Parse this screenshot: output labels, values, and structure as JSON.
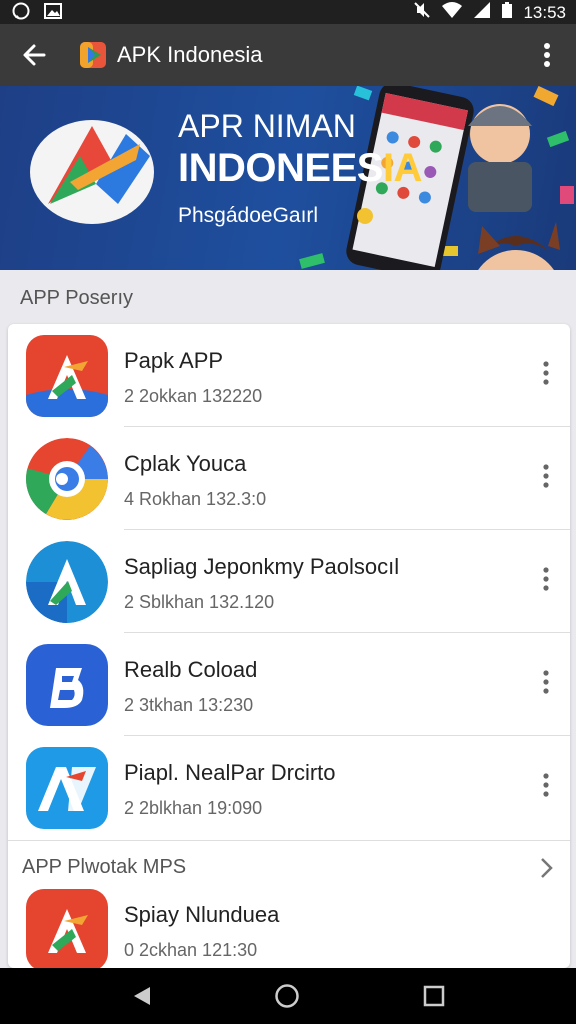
{
  "status_bar": {
    "time": "13:53",
    "left_icons": [
      "whatsapp-icon",
      "image-icon"
    ],
    "right_icons": [
      "mute-icon",
      "wifi-icon",
      "signal-icon",
      "battery-icon"
    ]
  },
  "toolbar": {
    "title": "APK Indonesia",
    "back_icon": "back-arrow-icon",
    "menu_icon": "overflow-menu-icon"
  },
  "banner": {
    "line1": "APR NIMAN",
    "line2a": "INDONEES",
    "line2b": "IA",
    "line3": "PhsgádoeGaırl"
  },
  "section1": {
    "label": "APP Poserıy"
  },
  "apps": [
    {
      "name": "Papk APP",
      "meta": "2 2okkan 132220",
      "icon": "app-icon-red-a"
    },
    {
      "name": "Cplak Youca",
      "meta": "4 Rokhan 132.3:0",
      "icon": "app-icon-chrome-like"
    },
    {
      "name": "Sapliag Jeponkmy Paolsocıl",
      "meta": "2 Sblkhan 132.120",
      "icon": "app-icon-teal-a"
    },
    {
      "name": "Realb Coload",
      "meta": "2 3tkhan 13:230",
      "icon": "app-icon-blue-8"
    },
    {
      "name": "Piapl. NealPar Drcirto",
      "meta": "2 2blkhan 19:090",
      "icon": "app-icon-blue-a"
    }
  ],
  "section2": {
    "label": "APP Plwotak MPS"
  },
  "last_app": {
    "name": "Spiay Nlunduea",
    "meta": "0 2ckhan 121:30",
    "icon": "app-icon-red-a"
  },
  "colors": {
    "toolbar": "#3a3a3a",
    "banner": "#1e4f9e",
    "accent_yellow": "#ffcb3a"
  }
}
